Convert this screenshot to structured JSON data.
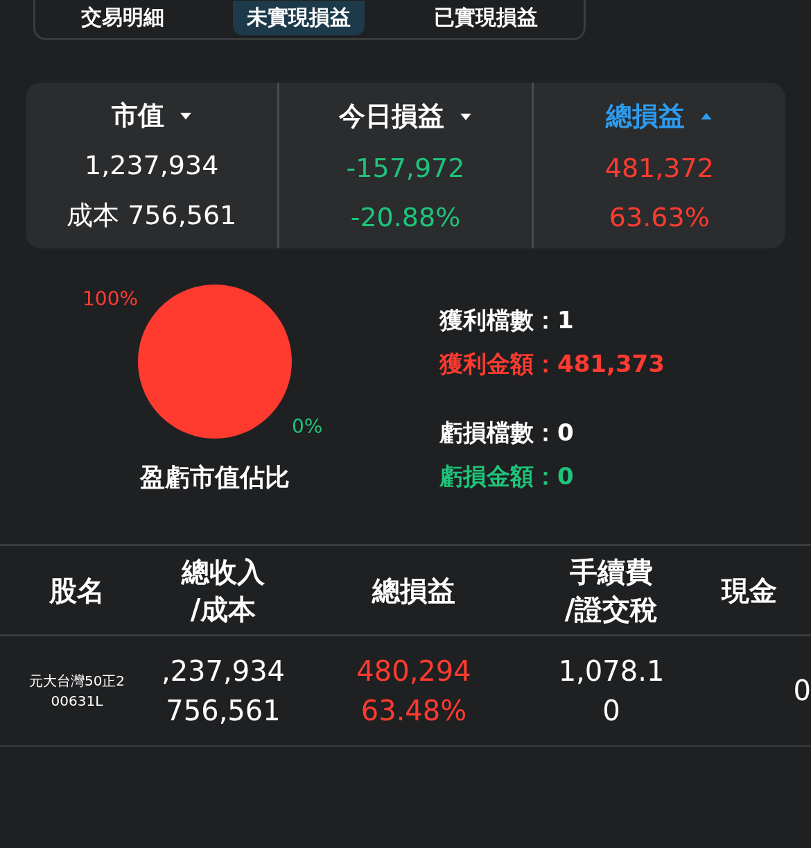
{
  "tabs": [
    {
      "label": "交易明細",
      "selected": false
    },
    {
      "label": "未實現損益",
      "selected": true
    },
    {
      "label": "已實現損益",
      "selected": false
    }
  ],
  "summary": [
    {
      "label": "市值",
      "selected": false,
      "ascending": false,
      "value": "1,237,934",
      "sub": "成本 756,561",
      "color": "#ffffff"
    },
    {
      "label": "今日損益",
      "selected": false,
      "ascending": false,
      "value": "-157,972",
      "sub": "-20.88%",
      "color": "#1ec47a"
    },
    {
      "label": "總損益",
      "selected": true,
      "ascending": true,
      "value": "481,372",
      "sub": "63.63%",
      "color": "#ff3b30"
    }
  ],
  "chart_data": {
    "type": "pie",
    "title": "盈虧市值佔比",
    "values": [
      100,
      0
    ],
    "colors": [
      "#ff3b30",
      "#1ec47a"
    ],
    "value_labels": [
      "100%",
      "0%"
    ]
  },
  "stat_groups": [
    {
      "items": [
        {
          "label": "獲利檔數：",
          "value": "1",
          "color": "#ffffff"
        },
        {
          "label": "獲利金額：",
          "value": "481,373",
          "color": "#ff3b30"
        }
      ]
    },
    {
      "items": [
        {
          "label": "虧損檔數：",
          "value": "0",
          "color": "#ffffff"
        },
        {
          "label": "虧損金額：",
          "value": "0",
          "color": "#1ec47a"
        }
      ]
    }
  ],
  "table": {
    "columns": [
      [
        "股名"
      ],
      [
        "總收入",
        "/成本"
      ],
      [
        "總損益"
      ],
      [
        "手續費",
        "/證交稅"
      ],
      [
        "現金"
      ]
    ],
    "rows": [
      {
        "name": "元大台灣50正2",
        "code": "00631L",
        "revenue": ",237,934",
        "cost": "756,561",
        "pnl": "480,294",
        "pnl_pct": "63.48%",
        "color": "#ff3b30",
        "fee": "1,078.1",
        "tax": "0",
        "column_5": "0"
      }
    ]
  }
}
